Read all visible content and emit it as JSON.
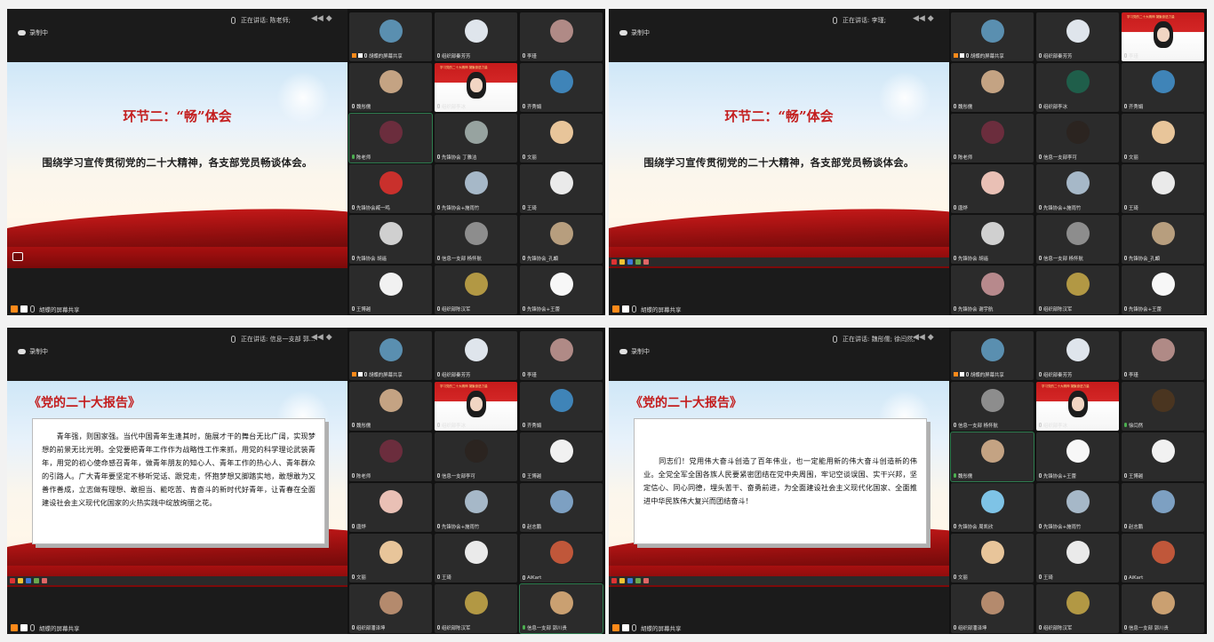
{
  "common": {
    "recording": "录制中",
    "sharer": "胡蝶的屏幕共享"
  },
  "panels": [
    {
      "speaking": "正在讲话: 陈老师;",
      "slide_title": "环节二：“畅”体会",
      "slide_subtitle": "围绕学习宣传贯彻党的二十大精神，各支部党员畅谈体会。",
      "tiles": [
        {
          "name": "胡蝶的屏幕共享",
          "color": "#5a8fb0",
          "sharer": true
        },
        {
          "name": "组织部秦芳芳",
          "color": "#dfe5ec"
        },
        {
          "name": "李瑾",
          "color": "#b08a86"
        },
        {
          "name": "魏彤儒",
          "color": "#c4a383"
        },
        {
          "name": "组织部李冰",
          "video": true,
          "video_text": "学习党的二十大精神 凝聚奋进力量"
        },
        {
          "name": "齐秀娟",
          "color": "#3f84b8"
        },
        {
          "name": "陈老师",
          "color": "#6b2d3d",
          "mic_on": true,
          "active": true
        },
        {
          "name": "先锋协会 丁雅洁",
          "color": "#97a3a0"
        },
        {
          "name": "文丽",
          "color": "#e8c59a"
        },
        {
          "name": "先锋协会臧一鸣",
          "color": "#c9302c"
        },
        {
          "name": "先锋协会+施雨竹",
          "color": "#a6b8c8"
        },
        {
          "name": "王琦",
          "color": "#eaeaea"
        },
        {
          "name": "先锋协会 胡遥",
          "color": "#d0d0d0"
        },
        {
          "name": "信息一支部 杨怀航",
          "color": "#8d8d8d"
        },
        {
          "name": "先锋协会_孔頔",
          "color": "#b79e7e"
        },
        {
          "name": "王博越",
          "color": "#f1f1f1"
        },
        {
          "name": "组织部陈汉军",
          "color": "#b29844"
        },
        {
          "name": "先锋协会+王蕾",
          "color": "#f7f7f7"
        }
      ]
    },
    {
      "speaking": "正在讲话: 李瑾;",
      "slide_title": "环节二：“畅”体会",
      "slide_subtitle": "围绕学习宣传贯彻党的二十大精神，各支部党员畅谈体会。",
      "tiles": [
        {
          "name": "胡蝶的屏幕共享",
          "color": "#5a8fb0",
          "sharer": true
        },
        {
          "name": "组织部秦芳芳",
          "color": "#dfe5ec"
        },
        {
          "name": "李瑾",
          "video": true,
          "video_text": "学习党的二十大精神 凝聚奋进力量"
        },
        {
          "name": "魏彤儒",
          "color": "#c4a383"
        },
        {
          "name": "组织部李冰",
          "color": "#1f5e4a"
        },
        {
          "name": "齐秀娟",
          "color": "#3f84b8"
        },
        {
          "name": "陈老师",
          "color": "#6b2d3d"
        },
        {
          "name": "信息一支部李可",
          "color": "#2b2420"
        },
        {
          "name": "文丽",
          "color": "#e8c59a"
        },
        {
          "name": "唐烨",
          "color": "#e9c0b5"
        },
        {
          "name": "先锋协会+施雨竹",
          "color": "#a6b8c8"
        },
        {
          "name": "王琦",
          "color": "#eaeaea"
        },
        {
          "name": "先锋协会 胡遥",
          "color": "#d0d0d0"
        },
        {
          "name": "信息一支部 杨怀航",
          "color": "#8d8d8d"
        },
        {
          "name": "先锋协会_孔頔",
          "color": "#b79e7e"
        },
        {
          "name": "先锋协会  谢宇航",
          "color": "#b7898c"
        },
        {
          "name": "组织部陈汉军",
          "color": "#b29844"
        },
        {
          "name": "先锋协会+王蕾",
          "color": "#f7f7f7"
        }
      ]
    },
    {
      "speaking": "正在讲话: 信息一支部 郭...",
      "doc_title": "《党的二十大报告》",
      "doc_text": "　　青年强，则国家强。当代中国青年生逢其时，施展才干的舞台无比广阔，实现梦想的前景无比光明。全党要把青年工作作为战略性工作来抓，用党的科学理论武装青年，用党的初心使命感召青年，做青年朋友的知心人、青年工作的热心人、青年群众的引路人。广大青年要坚定不移听党话、跟党走，怀抱梦想又脚踏实地，敢想敢为又善作善成，立志做有理想、敢担当、能吃苦、肯奋斗的新时代好青年，让青春在全面建设社会主义现代化国家的火热实践中绽放绚丽之花。",
      "tiles": [
        {
          "name": "胡蝶的屏幕共享",
          "color": "#5a8fb0",
          "sharer": true
        },
        {
          "name": "组织部秦芳芳",
          "color": "#dfe5ec"
        },
        {
          "name": "李瑾",
          "color": "#b08a86"
        },
        {
          "name": "魏彤儒",
          "color": "#c4a383"
        },
        {
          "name": "组织部李冰",
          "video": true,
          "video_text": "学习党的二十大精神 凝聚奋进力量"
        },
        {
          "name": "齐秀娟",
          "color": "#3f84b8"
        },
        {
          "name": "陈老师",
          "color": "#6b2d3d"
        },
        {
          "name": "信息一支部李可",
          "color": "#2b2420"
        },
        {
          "name": "王博越",
          "color": "#f1f1f1"
        },
        {
          "name": "唐烨",
          "color": "#e9c0b5"
        },
        {
          "name": "先锋协会+施雨竹",
          "color": "#a6b8c8"
        },
        {
          "name": "赵志鹏",
          "color": "#7da0c2"
        },
        {
          "name": "文丽",
          "color": "#e8c59a"
        },
        {
          "name": "王琦",
          "color": "#eaeaea"
        },
        {
          "name": "AiKart",
          "color": "#c0573a"
        },
        {
          "name": "组织部潘泽坤",
          "color": "#b48a6d"
        },
        {
          "name": "组织部陈汉军",
          "color": "#b29844"
        },
        {
          "name": "信息一支部 郭川贵",
          "color": "#caa071",
          "mic_on": true,
          "active": true
        }
      ]
    },
    {
      "speaking": "正在讲话: 魏彤儒; 徐闫然;",
      "doc_title": "《党的二十大报告》",
      "doc_text": "　　同志们！党用伟大奋斗创造了百年伟业，也一定能用新的伟大奋斗创造新的伟业。全党全军全国各族人民要紧密团结在党中央周围，牢记空谈误国、实干兴邦，坚定信心、同心同德，埋头苦干、奋勇前进，为全面建设社会主义现代化国家、全面推进中华民族伟大复兴而团结奋斗！",
      "tiles": [
        {
          "name": "胡蝶的屏幕共享",
          "color": "#5a8fb0",
          "sharer": true
        },
        {
          "name": "组织部秦芳芳",
          "color": "#dfe5ec"
        },
        {
          "name": "李瑾",
          "color": "#b08a86"
        },
        {
          "name": "信息一支部 杨怀航",
          "color": "#8d8d8d"
        },
        {
          "name": "组织部李冰",
          "video": true,
          "video_text": "学习党的二十大精神 凝聚奋进力量"
        },
        {
          "name": "徐闫然",
          "color": "#4a3520",
          "mic_on": true
        },
        {
          "name": "魏彤儒",
          "color": "#c4a383",
          "mic_on": true,
          "active": true
        },
        {
          "name": "先锋协会+王蕾",
          "color": "#f7f7f7"
        },
        {
          "name": "王博越",
          "color": "#f1f1f1"
        },
        {
          "name": "先锋协会 周凯欣",
          "color": "#7ec3e6"
        },
        {
          "name": "先锋协会+施雨竹",
          "color": "#a6b8c8"
        },
        {
          "name": "赵志鹏",
          "color": "#7da0c2"
        },
        {
          "name": "文丽",
          "color": "#e8c59a"
        },
        {
          "name": "王琦",
          "color": "#eaeaea"
        },
        {
          "name": "AiKart",
          "color": "#c0573a"
        },
        {
          "name": "组织部潘泽坤",
          "color": "#b48a6d"
        },
        {
          "name": "组织部陈汉军",
          "color": "#b29844"
        },
        {
          "name": "信息一支部 郭川贵",
          "color": "#caa071"
        }
      ]
    }
  ]
}
